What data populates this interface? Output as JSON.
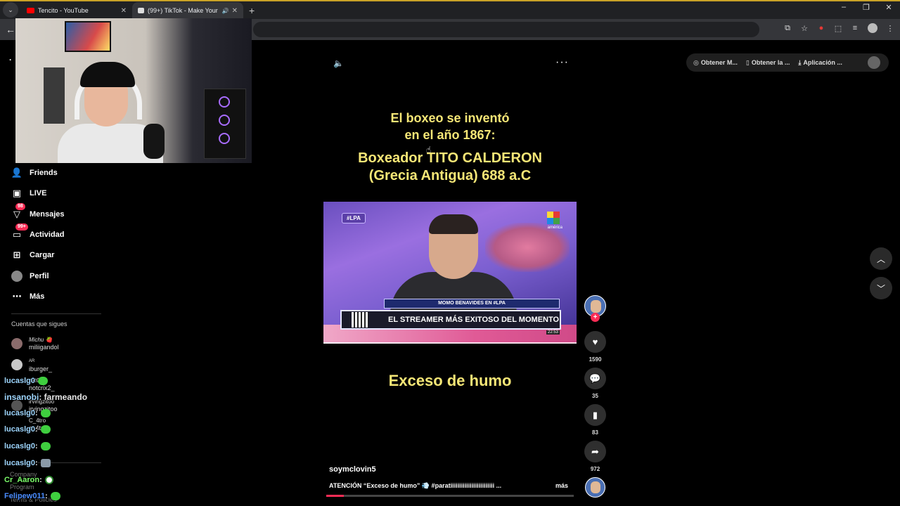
{
  "browser": {
    "tabs": [
      {
        "title": "Tencito - YouTube",
        "active": false,
        "favicon_color": "#ff0000"
      },
      {
        "title": "(99+) TikTok - Make Your Day",
        "active": true,
        "favicon_color": "#ffffff"
      }
    ],
    "new_tab": "+",
    "window_controls": [
      "–",
      "❐",
      "✕"
    ]
  },
  "tiktok": {
    "nav": [
      {
        "label": "Friends",
        "icon": "friends-icon"
      },
      {
        "label": "LIVE",
        "icon": "live-icon"
      },
      {
        "label": "Mensajes",
        "icon": "messages-icon",
        "badge": "98"
      },
      {
        "label": "Actividad",
        "icon": "activity-icon",
        "badge": "99+"
      },
      {
        "label": "Cargar",
        "icon": "upload-icon"
      },
      {
        "label": "Perfil",
        "icon": "profile-icon"
      },
      {
        "label": "Más",
        "icon": "more-icon"
      }
    ],
    "following_title": "Cuentas que sigues",
    "following": [
      {
        "display": "Michu 🍓",
        "handle": "miliigandol"
      },
      {
        "display": "AR",
        "handle": "iburger_"
      },
      {
        "display": "nxtCrix",
        "handle": "notcrix2_"
      },
      {
        "display": "irvingzitoo",
        "handle": "irvingzitoo"
      },
      {
        "display": "C_4tro",
        "handle": "c_4tro"
      }
    ],
    "footer": [
      "Company",
      "Program",
      "Terms & Policies"
    ],
    "get_bar": [
      {
        "label": "Obtener M...",
        "icon": "coin-icon"
      },
      {
        "label": "Obtener la ...",
        "icon": "phone-icon"
      },
      {
        "label": "Aplicación ...",
        "icon": "download-icon"
      }
    ]
  },
  "chat": [
    {
      "user": "lucaslg0",
      "text": "",
      "emote": "green",
      "color": "u"
    },
    {
      "user": "insanobi",
      "text": " : farmeando",
      "emote": "",
      "color": "u"
    },
    {
      "user": "lucaslg0",
      "text": " : ",
      "emote": "green",
      "color": "u"
    },
    {
      "user": "lucaslg0",
      "text": " : ",
      "emote": "green",
      "color": "u"
    },
    {
      "user": "lucaslg0",
      "text": " : ",
      "emote": "green",
      "color": "u"
    },
    {
      "user": "lucaslg0",
      "text": " : ",
      "emote": "grey",
      "color": "u"
    },
    {
      "user": "Cr_Aaron",
      "text": " : ",
      "emote": "ball",
      "color": "u green"
    },
    {
      "user": "Felipew011",
      "text": " : ",
      "emote": "green",
      "color": "u blue"
    }
  ],
  "video": {
    "text_line1": "El boxeo se inventó",
    "text_line2": "en el año 1867:",
    "text_line3": "Boxeador TITO CALDERON",
    "text_line4": "(Grecia Antigua) 688 a.C",
    "text_bottom": "Exceso de humo",
    "clip": {
      "tag": "#LPA",
      "channel": "américa",
      "lower_small": "MOMO BENAVIDES EN #LPA",
      "lower_big": "EL STREAMER MÁS EXITOSO DEL MOMENTO",
      "timestamp": "22:53"
    },
    "author": "soymclovin5",
    "caption": "ATENCIÓN “Exceso de humo” 💨 #paratiiiiiiiiiiiiiiiiiiiiiiiii ...",
    "caption_more": "más",
    "progress": 0.07
  },
  "actions": {
    "likes": "1590",
    "comments": "35",
    "saves": "83",
    "shares": "972"
  }
}
